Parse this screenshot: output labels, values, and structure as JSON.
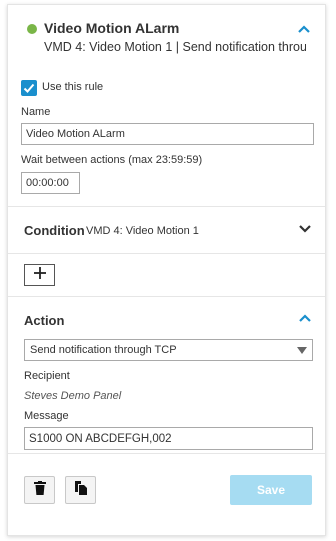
{
  "rule": {
    "title": "Video Motion ALarm",
    "subtitle": "VMD 4: Video Motion 1 | Send notification throu",
    "status_color": "#7ab648",
    "expanded_icon": "chevron-up-icon",
    "use_rule": {
      "label": "Use this rule",
      "checked": true
    },
    "name": {
      "label": "Name",
      "value": "Video Motion ALarm"
    },
    "wait": {
      "label": "Wait between actions (max 23:59:59)",
      "value": "00:00:00"
    }
  },
  "condition": {
    "title": "Condition",
    "detail": "VMD 4: Video Motion 1",
    "toggle_icon": "chevron-down-icon"
  },
  "add_condition": {
    "icon": "plus-icon"
  },
  "action": {
    "title": "Action",
    "toggle_icon": "chevron-up-icon",
    "type": {
      "selected": "Send notification through TCP"
    },
    "recipient": {
      "label": "Recipient",
      "value": "Steves Demo Panel"
    },
    "message": {
      "label": "Message",
      "value": "S1000 ON ABCDEFGH,002"
    }
  },
  "footer": {
    "delete_icon": "trash-icon",
    "copy_icon": "copy-icon",
    "save_label": "Save"
  },
  "colors": {
    "accent": "#1a8fcd",
    "status_active": "#7ab648",
    "save_disabled": "#a6dcf2"
  }
}
